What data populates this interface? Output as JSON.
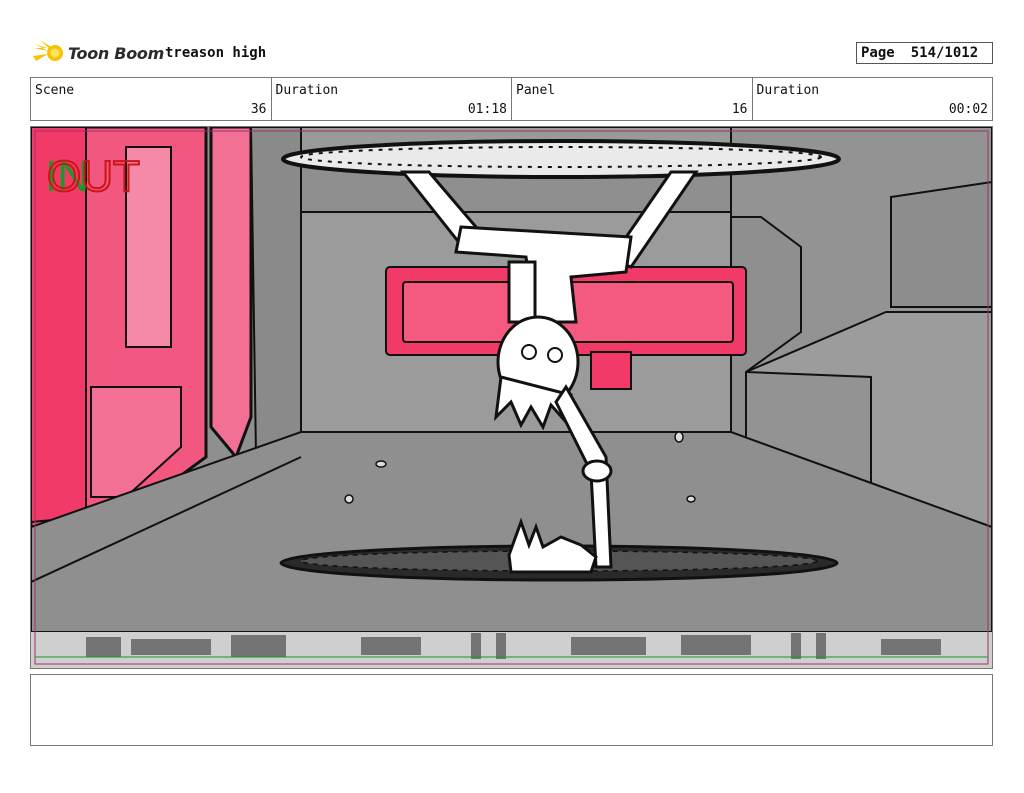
{
  "header": {
    "logo_text": "Toon Boom",
    "project_title": "treason high",
    "page_label": "Page",
    "page_number": "514/1012"
  },
  "info": [
    {
      "label": "Scene",
      "value": "36"
    },
    {
      "label": "Duration",
      "value": "01:18"
    },
    {
      "label": "Panel",
      "value": "16"
    },
    {
      "label": "Duration",
      "value": "00:02"
    }
  ],
  "panel": {
    "overlay_in": "IN",
    "overlay_out": "OUT",
    "colors": {
      "wall_pink": "#f2577f",
      "wall_pink_light": "#f27094",
      "sign_pink": "#f23a68",
      "floor_gray": "#8f8f8f",
      "in_green": "#1a9a2a",
      "out_red": "#cc1515"
    }
  },
  "notes": {
    "text": ""
  }
}
